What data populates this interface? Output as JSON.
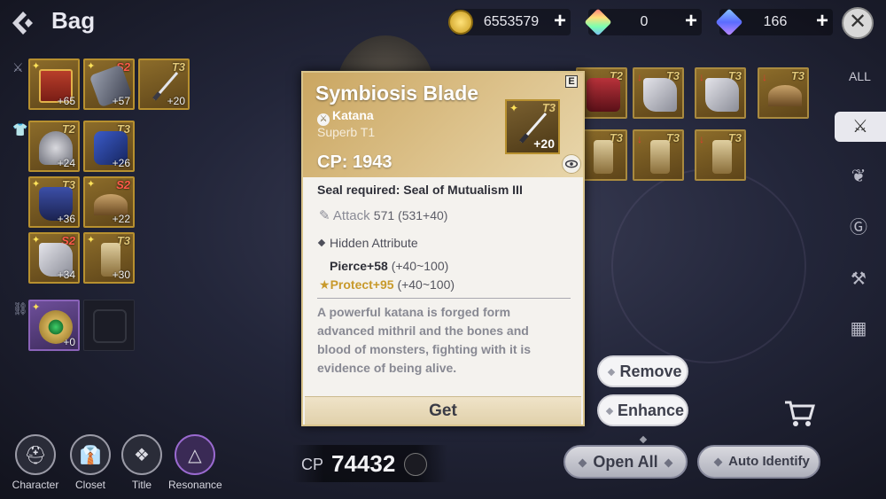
{
  "header": {
    "title": "Bag",
    "currencies": [
      {
        "icon": "gold-coin-icon",
        "value": "6553579"
      },
      {
        "icon": "rainbow-gem-icon",
        "value": "0"
      },
      {
        "icon": "blue-crystal-icon",
        "value": "166"
      }
    ]
  },
  "left_inventory": {
    "weapon_slots": [
      {
        "tier": "",
        "level": "+65",
        "icon": "book-icon"
      },
      {
        "tier": "S2",
        "level": "+57",
        "icon": "gauntlet-icon"
      },
      {
        "tier": "T3",
        "level": "+20",
        "icon": "katana-icon"
      }
    ],
    "armor_slots": [
      {
        "tier": "T2",
        "level": "+24",
        "icon": "helmet-icon"
      },
      {
        "tier": "T3",
        "level": "+26",
        "icon": "gloves-icon"
      },
      {
        "tier": "T3",
        "level": "+36",
        "icon": "armor-icon"
      },
      {
        "tier": "S2",
        "level": "+22",
        "icon": "shoulder-icon"
      },
      {
        "tier": "S2",
        "level": "+34",
        "icon": "boots-icon"
      },
      {
        "tier": "T3",
        "level": "+30",
        "icon": "greaves-icon"
      }
    ],
    "accessory_slots": [
      {
        "tier": "",
        "level": "+0",
        "icon": "emerald-medallion-icon"
      }
    ]
  },
  "right_inventory": [
    {
      "tier": "T2"
    },
    {
      "tier": "T3"
    },
    {
      "tier": "T3"
    },
    {
      "tier": "T3"
    },
    {
      "tier": "T3"
    },
    {
      "tier": "T3"
    },
    {
      "tier": "T3"
    }
  ],
  "categories": {
    "all_label": "ALL",
    "items": [
      "sword-icon",
      "leaf-icon",
      "g-coin-icon",
      "anvil-icon",
      "grid-icon"
    ]
  },
  "bottom_nav": [
    {
      "label": "Character",
      "icon": "helmet-icon"
    },
    {
      "label": "Closet",
      "icon": "shirt-icon"
    },
    {
      "label": "Title",
      "icon": "crest-icon"
    },
    {
      "label": "Resonance",
      "icon": "triangle-emblem-icon"
    }
  ],
  "cp_bar": {
    "label": "CP",
    "value": "74432"
  },
  "actions": {
    "open_all": "Open All",
    "auto_identify": "Auto Identify",
    "remove": "Remove",
    "enhance": "Enhance"
  },
  "item_card": {
    "badge": "E",
    "name": "Symbiosis Blade",
    "type": "Katana",
    "grade": "Superb T1",
    "cp": "CP: 1943",
    "thumb_tier": "T3",
    "thumb_level": "+20",
    "seal": "Seal required: Seal of Mutualism III",
    "attack_label": "Attack",
    "attack_value": "571 (531+40)",
    "hidden_header": "Hidden Attribute",
    "pierce": "Pierce+58",
    "pierce_range": "(+40~100)",
    "protect": "Protect+95",
    "protect_range": "(+40~100)",
    "description": "A powerful katana is forged form advanced mithril and the bones and blood of monsters, fighting with it is evidence of being alive.",
    "get_label": "Get"
  }
}
